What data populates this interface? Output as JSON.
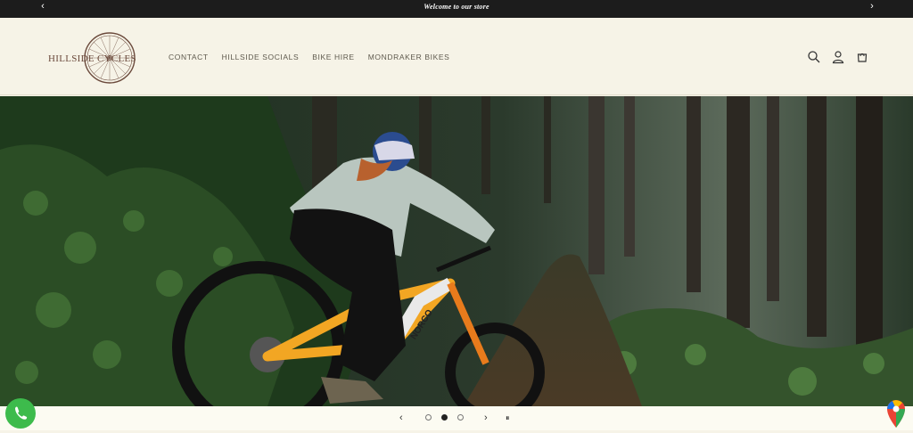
{
  "announcement": {
    "message": "Welcome to our store",
    "prev_icon": "chevron-left-icon",
    "next_icon": "chevron-right-icon",
    "prev_glyph": "‹",
    "next_glyph": "›"
  },
  "header": {
    "logo_text": "HILLSIDE CYCLES",
    "nav": [
      {
        "label": "CONTACT"
      },
      {
        "label": "HILLSIDE SOCIALS"
      },
      {
        "label": "BIKE HIRE"
      },
      {
        "label": "MONDRAKER BIKES"
      }
    ],
    "icons": [
      "search-icon",
      "account-icon",
      "cart-icon"
    ]
  },
  "hero": {
    "frame_brand": "NORCO"
  },
  "slideshow": {
    "prev_glyph": "‹",
    "next_glyph": "›",
    "pause_glyph": "⏸",
    "slide_count": 3,
    "active_slide": 2
  },
  "floating": {
    "whatsapp_icon": "whatsapp-icon",
    "maps_icon": "google-maps-icon"
  },
  "colors": {
    "announcement_bg": "#1c1c1c",
    "header_bg": "#f6f3e7",
    "whatsapp_green": "#3dbb4c"
  }
}
